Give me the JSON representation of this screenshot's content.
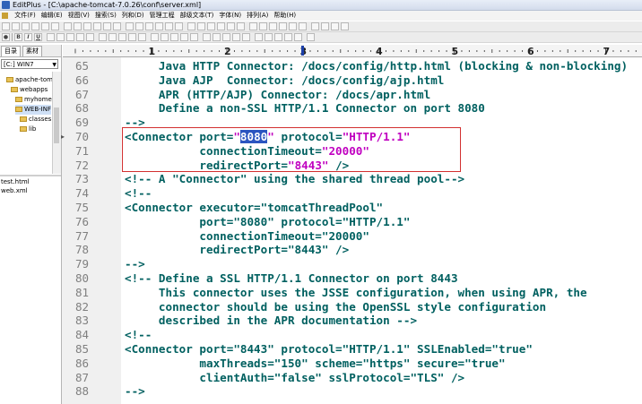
{
  "window": {
    "title": "EditPlus - [C:\\apache-tomcat-7.0.26\\conf\\server.xml]"
  },
  "menu": [
    "文件(F)",
    "编辑(E)",
    "视图(V)",
    "搜索(S)",
    "列和(D)",
    "管理工程",
    "部级文本(T)",
    "字体(N)",
    "排列(A)",
    "帮助(H)"
  ],
  "toolbar2": {
    "bold": "B",
    "italic": "I",
    "underline": "U"
  },
  "panel": {
    "tabs": [
      "目录",
      "素材"
    ],
    "drive": "[C:] WIN7",
    "tree": [
      {
        "label": "apache-tom",
        "indent": 1
      },
      {
        "label": "webapps",
        "indent": 2
      },
      {
        "label": "myhome",
        "indent": 3
      },
      {
        "label": "WEB-INF",
        "indent": 3
      },
      {
        "label": "classes",
        "indent": 4
      },
      {
        "label": "lib",
        "indent": 4
      }
    ],
    "files": [
      "test.html",
      "web.xml"
    ]
  },
  "ruler": {
    "marks": [
      "1",
      "2",
      "3",
      "4",
      "5",
      "6",
      "7"
    ]
  },
  "editor": {
    "lines": [
      {
        "num": "65",
        "parts": [
          {
            "t": "     Java HTTP Connector: /docs/config/http.html (blocking & non-blocking)"
          }
        ]
      },
      {
        "num": "66",
        "parts": [
          {
            "t": "     Java AJP  Connector: /docs/config/ajp.html"
          }
        ]
      },
      {
        "num": "67",
        "parts": [
          {
            "t": "     APR (HTTP/AJP) Connector: /docs/apr.html"
          }
        ]
      },
      {
        "num": "68",
        "parts": [
          {
            "t": "     Define a non-SSL HTTP/1.1 Connector on port 8080"
          }
        ]
      },
      {
        "num": "69",
        "parts": [
          {
            "t": "-->"
          }
        ]
      },
      {
        "num": "70",
        "parts": [
          {
            "t": "<Connector port="
          },
          {
            "t": "\"",
            "c": "s"
          },
          {
            "t": "8080",
            "c": "hl"
          },
          {
            "t": "\"",
            "c": "s"
          },
          {
            "t": " protocol="
          },
          {
            "t": "\"HTTP/1.1\"",
            "c": "s"
          }
        ]
      },
      {
        "num": "71",
        "parts": [
          {
            "t": "           connectionTimeout="
          },
          {
            "t": "\"20000\"",
            "c": "s"
          }
        ]
      },
      {
        "num": "72",
        "parts": [
          {
            "t": "           redirectPort="
          },
          {
            "t": "\"8443\"",
            "c": "s"
          },
          {
            "t": " />"
          }
        ]
      },
      {
        "num": "73",
        "parts": [
          {
            "t": "<!-- A \"Connector\" using the shared thread pool-->"
          }
        ]
      },
      {
        "num": "74",
        "parts": [
          {
            "t": "<!--"
          }
        ]
      },
      {
        "num": "75",
        "parts": [
          {
            "t": "<Connector executor=\"tomcatThreadPool\""
          }
        ]
      },
      {
        "num": "76",
        "parts": [
          {
            "t": "           port=\"8080\" protocol=\"HTTP/1.1\""
          }
        ]
      },
      {
        "num": "77",
        "parts": [
          {
            "t": "           connectionTimeout=\"20000\""
          }
        ]
      },
      {
        "num": "78",
        "parts": [
          {
            "t": "           redirectPort=\"8443\" />"
          }
        ]
      },
      {
        "num": "79",
        "parts": [
          {
            "t": "-->"
          }
        ]
      },
      {
        "num": "80",
        "parts": [
          {
            "t": "<!-- Define a SSL HTTP/1.1 Connector on port 8443"
          }
        ]
      },
      {
        "num": "81",
        "parts": [
          {
            "t": "     This connector uses the JSSE configuration, when using APR, the"
          }
        ]
      },
      {
        "num": "82",
        "parts": [
          {
            "t": "     connector should be using the OpenSSL style configuration"
          }
        ]
      },
      {
        "num": "83",
        "parts": [
          {
            "t": "     described in the APR documentation -->"
          }
        ]
      },
      {
        "num": "84",
        "parts": [
          {
            "t": "<!--"
          }
        ]
      },
      {
        "num": "85",
        "parts": [
          {
            "t": "<Connector port=\"8443\" protocol=\"HTTP/1.1\" SSLEnabled=\"true\""
          }
        ]
      },
      {
        "num": "86",
        "parts": [
          {
            "t": "           maxThreads=\"150\" scheme=\"https\" secure=\"true\""
          }
        ]
      },
      {
        "num": "87",
        "parts": [
          {
            "t": "           clientAuth=\"false\" sslProtocol=\"TLS\" />"
          }
        ]
      },
      {
        "num": "88",
        "parts": [
          {
            "t": "-->"
          }
        ]
      }
    ]
  }
}
